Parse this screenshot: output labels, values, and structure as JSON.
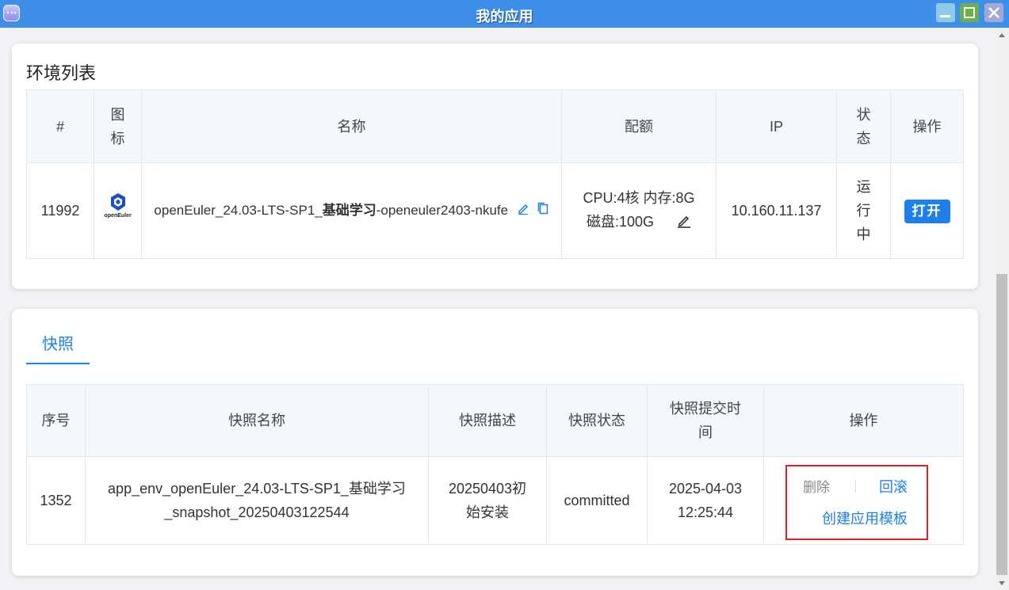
{
  "window": {
    "title": "我的应用"
  },
  "env": {
    "section_title": "环境列表",
    "headers": {
      "num": "#",
      "icon": "图标",
      "name": "名称",
      "quota": "配额",
      "ip": "IP",
      "status": "状态",
      "action": "操作"
    },
    "row": {
      "id": "11992",
      "logo_text": "openEuler",
      "name_prefix": "openEuler_24.03-LTS-SP1_",
      "name_bold": "基础学习",
      "name_suffix": "-openeuler2403-nkufe",
      "quota_line1": "CPU:4核 内存:8G",
      "quota_line2": "磁盘:100G",
      "ip": "10.160.11.137",
      "status": "运行中",
      "open_label": "打开"
    }
  },
  "snapshot": {
    "tab_label": "快照",
    "headers": {
      "seq": "序号",
      "name": "快照名称",
      "desc": "快照描述",
      "status": "快照状态",
      "time": "快照提交时间",
      "action": "操作"
    },
    "row": {
      "seq": "1352",
      "name_line1": "app_env_openEuler_24.03-LTS-SP1_基础学习",
      "name_line2": "_snapshot_20250403122544",
      "desc": "20250403初始安装",
      "status": "committed",
      "time_line1": "2025-04-03",
      "time_line2": "12:25:44",
      "delete_label": "删除",
      "rollback_label": "回滚",
      "template_label": "创建应用模板"
    }
  },
  "colors": {
    "titlebar": "#3e8fe8",
    "accent": "#1f7fe8",
    "highlight_box": "#e02020"
  },
  "icons": [
    "app-icon",
    "minimize-icon",
    "maximize-icon",
    "close-icon",
    "openeuler-logo",
    "edit-icon",
    "copy-icon"
  ]
}
